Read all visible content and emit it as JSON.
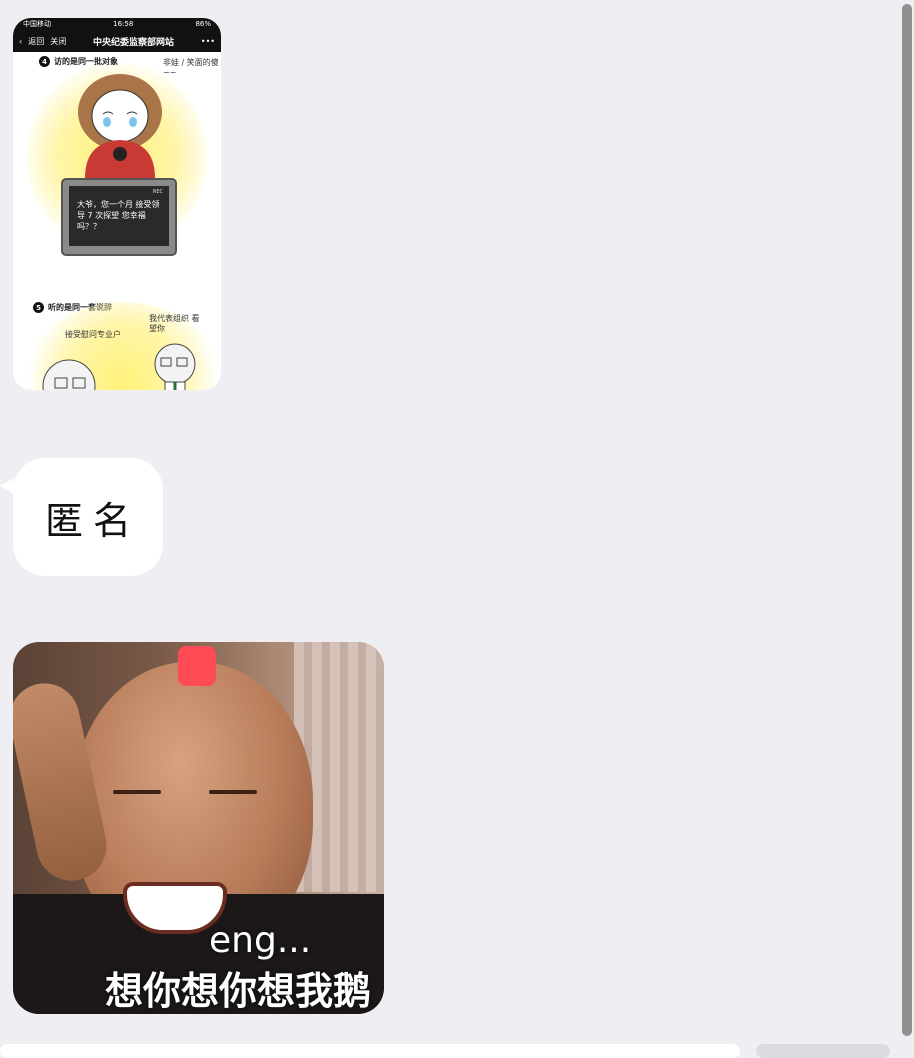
{
  "phone_screenshot": {
    "status_left": "中国移动",
    "status_time": "16:58",
    "status_right": "86%",
    "nav_back": "返回",
    "nav_close": "关闭",
    "nav_title": "中央纪委监察部网站",
    "nav_more": "•••",
    "section4_num": "4",
    "section4_title": "访的是同一批对象",
    "section4_note": "非娃 / 笑面的傻~~",
    "tv_rec": "REC",
    "tv_text": "大爷，您一个月 接受领导 7 次探望 您幸福吗？？",
    "section5_num": "5",
    "section5_title": "听的是同一套说辞",
    "section5_note_left": "接受慰问专业户",
    "section5_note_right": "我代表组织 看望你"
  },
  "bubble": {
    "text": "匿名"
  },
  "meme": {
    "caption_en": "eng...",
    "caption_cn": "想你想你想我鹅"
  }
}
